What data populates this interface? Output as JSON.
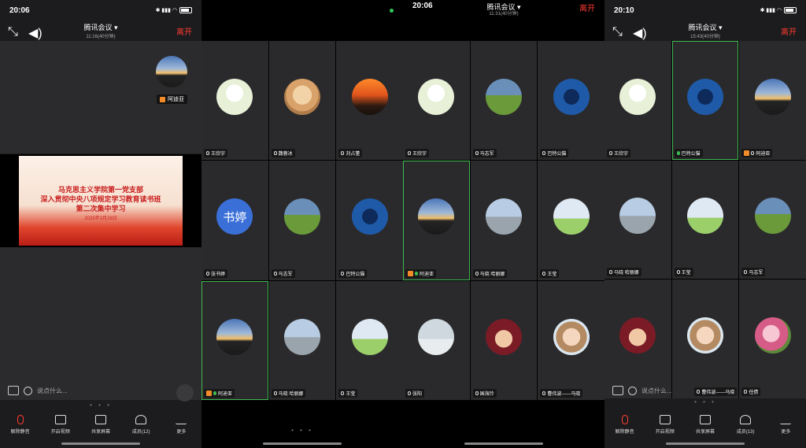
{
  "panels": [
    {
      "time": "20:06",
      "battery": "82",
      "title": "腾讯会议",
      "subtitle": "11:16(40分钟)",
      "leave": "离开",
      "self_name": "阿迪亚",
      "slide": {
        "line1": "马克思主义学院第一党支部",
        "line2": "深入贯彻中央八项规定学习教育读书班",
        "line3": "第二次集中学习",
        "date": "2025年3月28日"
      },
      "chat_placeholder": "说点什么...",
      "toolbar": [
        "解除静音",
        "开启视频",
        "共享屏幕",
        "成员(12)",
        "更多"
      ]
    },
    {
      "tiles": [
        "王欣宇",
        "魏蓉冰",
        "刘占董",
        "张书婷",
        "马志军",
        "巴特公猫",
        "阿迪亚",
        "马晓 哈丽娜",
        "王莹"
      ],
      "text_avatar": "书婷"
    },
    {
      "time": "20:06",
      "title": "腾讯会议",
      "subtitle": "11:31(40分钟)",
      "leave": "离开",
      "tiles": [
        "王欣宇",
        "马志军",
        "巴特公猫",
        "",
        "阿迪亚",
        "马晓 哈丽娜",
        "王莹",
        "张阳",
        "国海玲",
        "曹伟波——马晓"
      ]
    },
    {
      "time": "20:10",
      "battery": "80",
      "title": "腾讯会议",
      "subtitle": "15:43(40分钟)",
      "leave": "离开",
      "tiles": [
        "王欣宇",
        "巴特公猫",
        "阿迪亚",
        "马晓 哈丽娜",
        "王莹",
        "马志军",
        "",
        "曹伟波——马晓",
        "任倩"
      ],
      "chat_placeholder": "说点什么...",
      "toolbar": [
        "解除静音",
        "开启视频",
        "共享屏幕",
        "成员(13)",
        "更多"
      ]
    }
  ],
  "pager": "• • •"
}
